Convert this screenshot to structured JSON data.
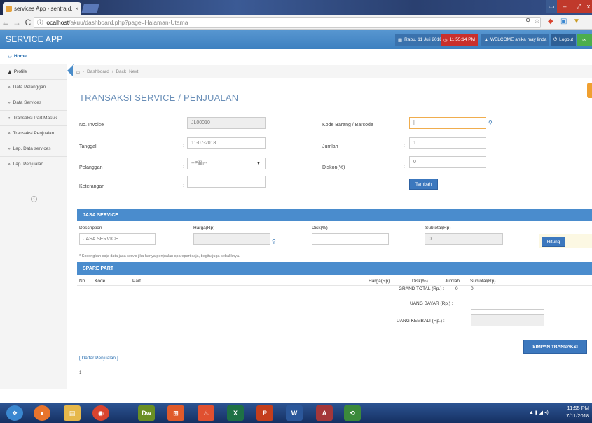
{
  "browser": {
    "tab_title": "services App - sentra d...",
    "tab_close": "×",
    "url_host": "localhost",
    "url_path": "/akuu/dashboard.php?page=Halaman-Utama",
    "window_controls": [
      "▭",
      "–",
      "⤢",
      "x"
    ]
  },
  "app": {
    "title": "SERVICE APP",
    "header": {
      "date": "Rabu, 11 Juli 2018",
      "time": "11:55:14 PM",
      "welcome": "WELCOME anika may linda",
      "logout": "Logout"
    }
  },
  "sidebar": {
    "items": [
      {
        "label": "Home",
        "icon": "sitemap-icon"
      },
      {
        "label": "Profile",
        "icon": "user-icon"
      },
      {
        "label": "Data Pelanggan",
        "icon": "double-chevron-icon"
      },
      {
        "label": "Data Services",
        "icon": "double-chevron-icon"
      },
      {
        "label": "Transaksi Part Masuk",
        "icon": "double-chevron-icon"
      },
      {
        "label": "Transaksi Penjualan",
        "icon": "double-chevron-icon"
      },
      {
        "label": "Lap. Data services",
        "icon": "double-chevron-icon"
      },
      {
        "label": "Lap. Penjualan",
        "icon": "double-chevron-icon"
      }
    ]
  },
  "breadcrumb": {
    "home_icon": "home-icon",
    "items": [
      "Dashboard",
      "Back",
      "Next"
    ]
  },
  "page_title": "TRANSAKSI SERVICE / PENJUALAN",
  "form": {
    "no_invoice": {
      "label": "No. Invoice",
      "value": "JL00010"
    },
    "tanggal": {
      "label": "Tanggal",
      "value": "11-07-2018"
    },
    "pelanggan": {
      "label": "Pelanggan",
      "value": "--Pilih--"
    },
    "keterangan": {
      "label": "Keterangan",
      "value": ""
    },
    "kode_barang": {
      "label": "Kode Barang / Barcode",
      "value": "|"
    },
    "jumlah": {
      "label": "Jumlah",
      "value": "1"
    },
    "diskon": {
      "label": "Diskon(%)",
      "value": "0"
    },
    "tambah": "Tambah",
    "colon": ":"
  },
  "jasa_service": {
    "title": "JASA SERVICE",
    "headers": {
      "description": "Description",
      "harga": "Harga(Rp)",
      "disk": "Disk(%)",
      "subtotal": "Subtotal(Rp)"
    },
    "description_value": "JASA SERVICE",
    "subtotal_value": "0",
    "hitung": "Hitung",
    "note": "* Kosongkan saja data jasa servis jika hanya penjualan sparepart saja, begitu juga sebaliknya."
  },
  "spare_part": {
    "title": "SPARE PART",
    "headers": {
      "no": "No",
      "kode": "Kode",
      "part": "Part",
      "harga": "Harga(Rp)",
      "disk": "Disk(%)",
      "jumlah": "Jumlah",
      "subtotal": "Subtotal(Rp)"
    },
    "grand_total_label": "GRAND TOTAL (Rp.) :",
    "grand_total_qty": "0",
    "grand_total_value": "0",
    "uang_bayar_label": "UANG BAYAR (Rp.) :",
    "uang_kembali_label": "UANG KEMBALI (Rp.) :",
    "simpan": "SIMPAN TRANSAKSI",
    "daftar_link": "[ Daftar Penjualan ]",
    "footer_num": "1"
  },
  "taskbar": {
    "apps": [
      {
        "name": "start-orb-icon",
        "glyph": "❖",
        "color": "#3a87d0"
      },
      {
        "name": "firefox-icon",
        "glyph": "●",
        "color": "#e8742c"
      },
      {
        "name": "explorer-folder-icon",
        "glyph": "▤",
        "color": "#e6b84a"
      },
      {
        "name": "chrome-icon",
        "glyph": "◉",
        "color": "#d9442f"
      },
      {
        "name": "dreamweaver-icon",
        "glyph": "Dw",
        "color": "#6a8f24"
      },
      {
        "name": "xampp-icon",
        "glyph": "⊞",
        "color": "#e05a2a"
      },
      {
        "name": "codeigniter-icon",
        "glyph": "♨",
        "color": "#e05030"
      },
      {
        "name": "excel-icon",
        "glyph": "X",
        "color": "#1e7145"
      },
      {
        "name": "powerpoint-icon",
        "glyph": "P",
        "color": "#c43e1c"
      },
      {
        "name": "word-icon",
        "glyph": "W",
        "color": "#2b579a"
      },
      {
        "name": "access-icon",
        "glyph": "A",
        "color": "#a4373a"
      },
      {
        "name": "network-icon",
        "glyph": "⟲",
        "color": "#3b8a3b"
      }
    ],
    "time": "11:55 PM",
    "date": "7/11/2018",
    "tray": "▲ ▮ ◢ ◂)"
  }
}
